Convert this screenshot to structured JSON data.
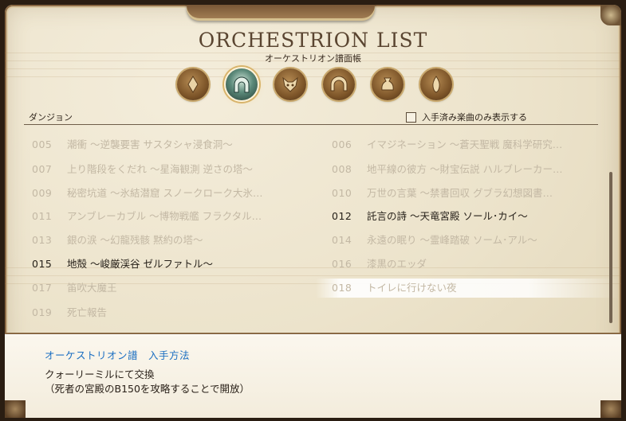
{
  "header": {
    "title": "ORCHESTRION LIST",
    "subtitle": "オーケストリオン譜面帳"
  },
  "categories": [
    {
      "icon": "crystal-icon",
      "selected": false
    },
    {
      "icon": "dungeon-gate-icon",
      "selected": true
    },
    {
      "icon": "beast-face-icon",
      "selected": false
    },
    {
      "icon": "arch-icon",
      "selected": false
    },
    {
      "icon": "bag-icon",
      "selected": false
    },
    {
      "icon": "flame-icon",
      "selected": false
    }
  ],
  "list_header": {
    "category_label": "ダンジョン",
    "filter_label": "入手済み楽曲のみ表示する"
  },
  "songs": [
    {
      "num": "005",
      "title": "潮衝 ～逆襲要害 サスタシャ浸食洞～",
      "obtained": false
    },
    {
      "num": "006",
      "title": "イマジネーション ～蒼天聖戦 魔科学研究…",
      "obtained": false
    },
    {
      "num": "007",
      "title": "上り階段をくだれ ～星海観測 逆さの塔～",
      "obtained": false
    },
    {
      "num": "008",
      "title": "地平線の彼方 ～財宝伝説 ハルブレーカー…",
      "obtained": false
    },
    {
      "num": "009",
      "title": "秘密坑道 ～氷結潜窟 スノークローク大氷…",
      "obtained": false
    },
    {
      "num": "010",
      "title": "万世の言葉 ～禁書回収 グブラ幻想図書…",
      "obtained": false
    },
    {
      "num": "011",
      "title": "アンブレーカブル ～博物戦艦 フラクタル…",
      "obtained": false
    },
    {
      "num": "012",
      "title": "託言の詩 ～天竜宮殿 ソール･カイ～",
      "obtained": true
    },
    {
      "num": "013",
      "title": "銀の涙 ～幻龍残骸 黙約の塔～",
      "obtained": false
    },
    {
      "num": "014",
      "title": "永遠の眠り ～霊峰踏破 ソーム･アル～",
      "obtained": false
    },
    {
      "num": "015",
      "title": "地殻 ～峻厳渓谷 ゼルファトル～",
      "obtained": true
    },
    {
      "num": "016",
      "title": "漆黒のエッダ",
      "obtained": false
    },
    {
      "num": "017",
      "title": "笛吹大魔王",
      "obtained": false
    },
    {
      "num": "018",
      "title": "トイレに行けない夜",
      "obtained": false,
      "hover": true
    },
    {
      "num": "019",
      "title": "死亡報告",
      "obtained": false
    }
  ],
  "info": {
    "title": "オーケストリオン譜　入手方法",
    "line1": "クォーリーミルにて交換",
    "line2": "（死者の宮殿のB150を攻略することで開放）"
  }
}
